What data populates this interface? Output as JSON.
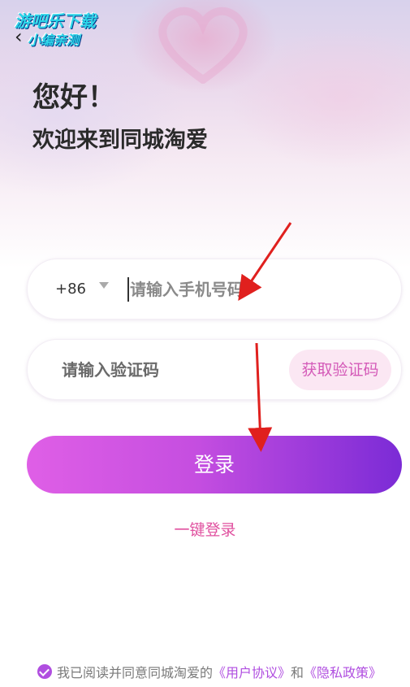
{
  "watermark": {
    "line1": "游吧乐下载",
    "line2": "小编亲测"
  },
  "nav": {
    "back_glyph": "‹"
  },
  "header": {
    "greeting": "您好！",
    "welcome": "欢迎来到同城淘爱"
  },
  "phone_field": {
    "country_code": "+86",
    "placeholder": "请输入手机号码"
  },
  "code_field": {
    "placeholder": "请输入验证码",
    "get_code_label": "获取验证码"
  },
  "actions": {
    "login_label": "登录",
    "quick_login_label": "一键登录"
  },
  "agreement": {
    "prefix": "我已阅读并同意同城淘爱的",
    "user_agreement": "《用户协议》",
    "and": "和",
    "privacy_policy": "《隐私政策》"
  },
  "colors": {
    "accent": "#b04ee0",
    "annotation_arrow": "#e0201e"
  }
}
